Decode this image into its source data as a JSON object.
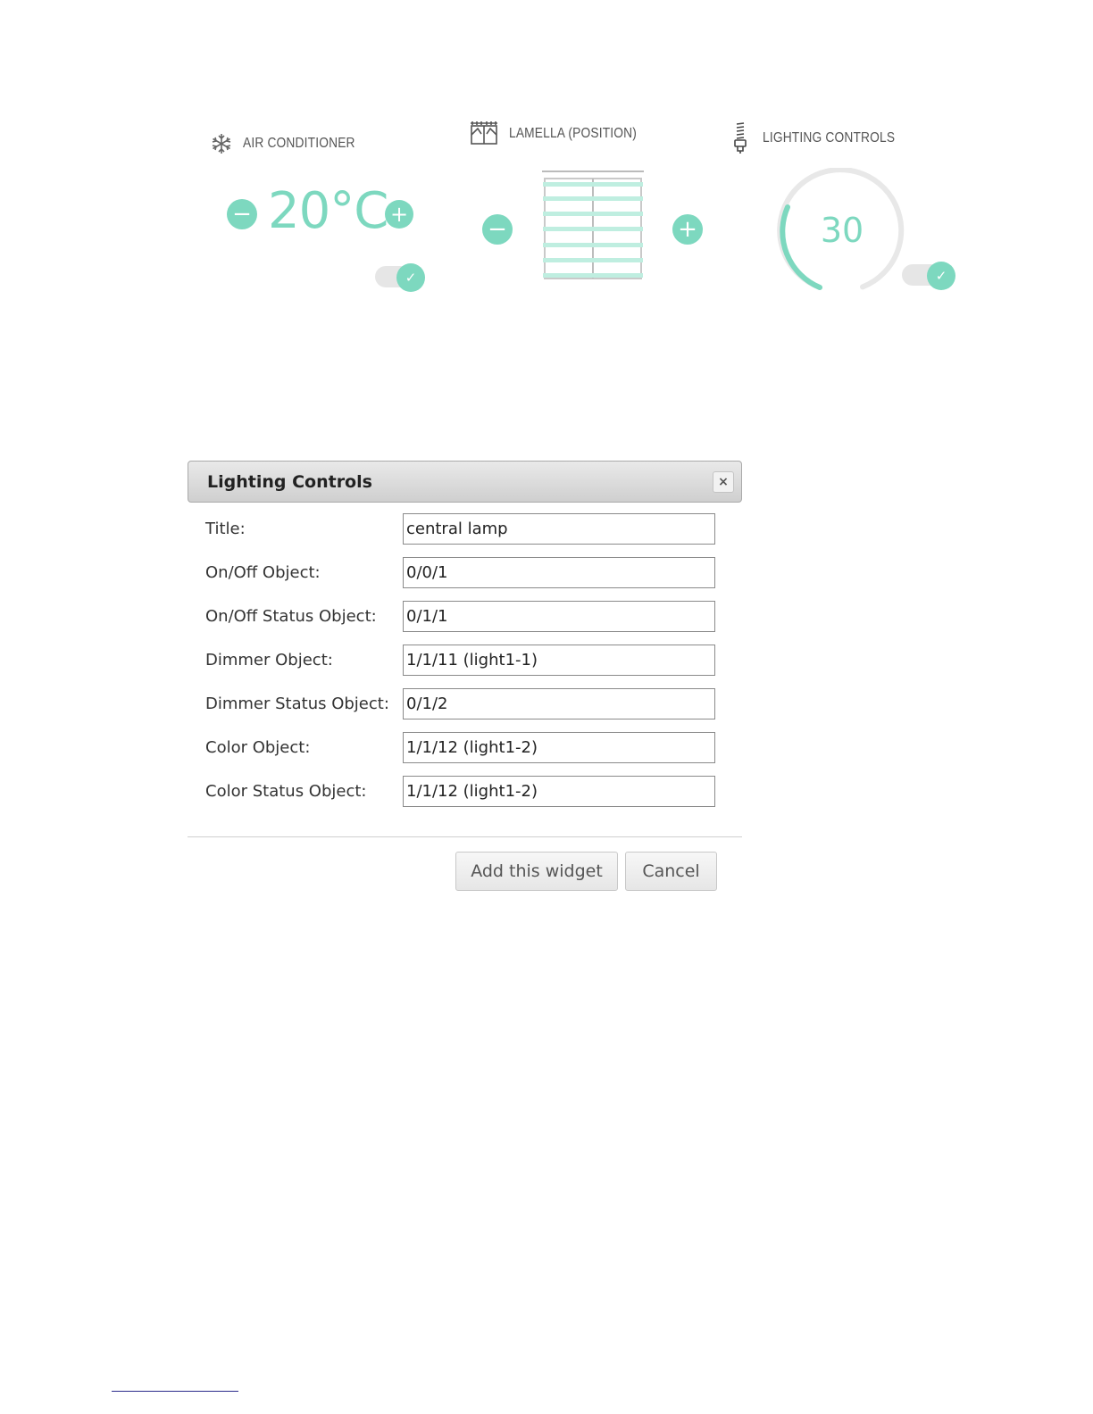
{
  "widgets": {
    "air_conditioner": {
      "title": "AIR CONDITIONER",
      "icon": "snowflake-icon",
      "temperature": "20°C",
      "minus": "−",
      "plus": "+",
      "toggle_on": true,
      "check": "✓"
    },
    "lamella": {
      "title": "LAMELLA (POSITION)",
      "icon": "window-blind-icon",
      "minus": "−",
      "plus": "+"
    },
    "lighting": {
      "title": "LIGHTING CONTROLS",
      "icon": "light-bulb-icon",
      "value": "30",
      "toggle_on": true,
      "check": "✓"
    }
  },
  "dialog": {
    "title": "Lighting Controls",
    "close": "×",
    "fields": [
      {
        "label": "Title:",
        "value": "central lamp"
      },
      {
        "label": "On/Off Object:",
        "value": "0/0/1"
      },
      {
        "label": "On/Off Status Object:",
        "value": "0/1/1"
      },
      {
        "label": "Dimmer Object:",
        "value": "1/1/11 (light1-1)"
      },
      {
        "label": "Dimmer Status Object:",
        "value": "0/1/2"
      },
      {
        "label": "Color Object:",
        "value": "1/1/12 (light1-2)"
      },
      {
        "label": "Color Status Object:",
        "value": "1/1/12 (light1-2)"
      }
    ],
    "add_button": "Add this widget",
    "cancel_button": "Cancel"
  },
  "colors": {
    "accent": "#7dd8bf",
    "track": "#e6e6e6"
  }
}
